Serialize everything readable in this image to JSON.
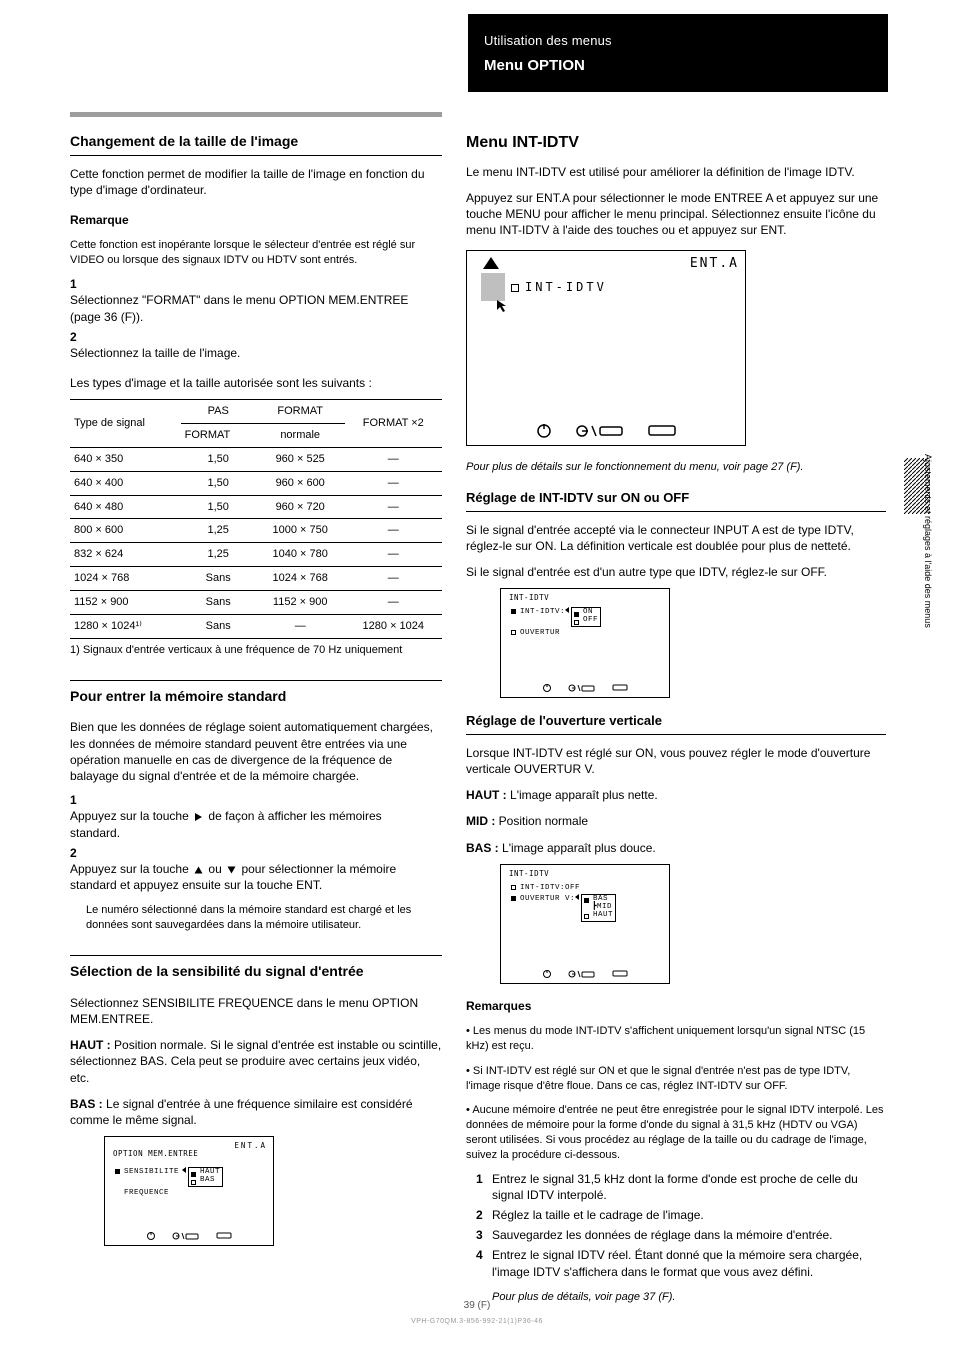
{
  "header": {
    "black_line1": "Utilisation des menus",
    "black_line2": "Menu OPTION"
  },
  "left": {
    "section1_title": "Changement de la taille de l'image",
    "section1_p1": "Cette fonction permet de modifier la taille de l'image en fonction du type d'image d'ordinateur.",
    "note_head": "Remarque",
    "note_body": "Cette fonction est inopérante lorsque le sélecteur d'entrée est réglé sur VIDEO ou lorsque des signaux IDTV ou HDTV sont entrés.",
    "step1": "Sélectionnez \"FORMAT\" dans le menu OPTION MEM.ENTREE (page 36 (F)).",
    "step2": "Sélectionnez la taille de l'image.",
    "formats_intro": "Les types d'image et la taille autorisée sont les suivants :",
    "table_note": "1) Signaux d'entrée verticaux à une fréquence de 70 Hz uniquement",
    "section2_title": "Pour entrer la mémoire standard",
    "section2_body": "Bien que les données de réglage soient automatiquement chargées, les données de mémoire standard peuvent être entrées via une opération manuelle en cas de divergence de la fréquence de balayage du signal d'entrée et de la mémoire chargée.",
    "section2_step1a": "Appuyez sur la touche ",
    "section2_step1b": " de façon à afficher les mémoires standard.",
    "section2_step2a": "Appuyez sur la touche ",
    "section2_step2b": " ou ",
    "section2_step2c": " pour sélectionner la mémoire standard et appuyez ensuite sur la touche ENT.",
    "section2_step3": "Le numéro sélectionné dans la mémoire standard est chargé et les données sont sauvegardées dans la mémoire utilisateur.",
    "section3_title": "Sélection de la sensibilité du signal d'entrée",
    "section3_step1": "Sélectionnez SENSIBILITE FREQUENCE dans le menu OPTION MEM.ENTREE.",
    "section3_step2a": "HAUT :",
    "section3_step2b": "Position normale. Si le signal d'entrée est instable ou scintille, sélectionnez BAS. Cela peut se produire avec certains jeux vidéo, etc.",
    "section3_step2c": "BAS :",
    "section3_step2d": "Le signal d'entrée à une fréquence similaire est considéré comme le même signal.",
    "osd_s3_title": "OPTION MEM.ENTREE",
    "osd_s3_enta": "ENT.A",
    "osd_s3_row1": "SENSIBILITE",
    "osd_s3_row2": "FREQUENCE",
    "osd_s3_opt1": "HAUT",
    "osd_s3_opt2": "BAS"
  },
  "right": {
    "intidtv_title": "Menu INT-IDTV",
    "intidtv_p1": "Le menu INT-IDTV est utilisé pour améliorer la définition de l'image IDTV.",
    "intidtv_p2": "Appuyez sur ENT.A pour sélectionner le mode ENTREE A et appuyez sur une touche MENU pour afficher le menu principal. Sélectionnez ensuite l'icône du menu INT-IDTV à l'aide des touches     ou     et appuyez sur ENT.",
    "osd_main_item": "INT-IDTV",
    "osd_main_enta": "ENT.A",
    "osd_main_foot": "Pour plus de détails sur le fonctionnement du menu, voir page 27 (F).",
    "sec_onoff_title": "Réglage de INT-IDTV sur ON ou OFF",
    "sec_onoff_b1": "Si le signal d'entrée accepté via le connecteur INPUT A est de type IDTV, réglez-le sur ON. La définition verticale est doublée pour plus de netteté.",
    "sec_onoff_b2": "Si le signal d'entrée est d'un autre type que IDTV, réglez-le sur OFF.",
    "osd_onoff_title": "INT-IDTV",
    "osd_onoff_row1": "INT-IDTV:",
    "osd_onoff_row2": "OUVERTUR",
    "osd_onoff_opt1": "ON",
    "osd_onoff_opt2": "OFF",
    "sec_vap_title": "Réglage de l'ouverture verticale",
    "sec_vap_p": "Lorsque INT-IDTV est réglé sur ON, vous pouvez régler le mode d'ouverture verticale OUVERTUR V.",
    "sec_vap_haut_l": "HAUT :",
    "sec_vap_haut_r": "L'image apparaît plus nette.",
    "sec_vap_mid_l": "MID :",
    "sec_vap_mid_r": "Position normale",
    "sec_vap_bas_l": "BAS :",
    "sec_vap_bas_r": "L'image apparaît plus douce.",
    "osd_vap_title": "INT-IDTV",
    "osd_vap_row1": "INT-IDTV:OFF",
    "osd_vap_row2": "OUVERTUR V:",
    "osd_vap_opt1": "BAS",
    "osd_vap_opt2": "MID",
    "osd_vap_opt3": "HAUT",
    "note_head": "Remarques",
    "note1": "Les menus du mode INT-IDTV s'affichent uniquement lorsqu'un signal NTSC (15 kHz) est reçu.",
    "note2": "Si INT-IDTV est réglé sur ON et que le signal d'entrée n'est pas de type IDTV, l'image risque d'être floue. Dans ce cas, réglez INT-IDTV sur OFF.",
    "note3p": "Aucune mémoire d'entrée ne peut être enregistrée pour le signal IDTV interpolé. Les données de mémoire pour la forme d'onde du signal à 31,5 kHz (HDTV ou VGA) seront utilisées. Si vous procédez au réglage de la taille ou du cadrage de l'image, suivez la procédure ci-dessous.",
    "note3_1": "Entrez le signal 31,5 kHz dont la forme d'onde est proche de celle du signal IDTV interpolé.",
    "note3_2": "Réglez la taille et le cadrage de l'image.",
    "note3_3": "Sauvegardez les données de réglage dans la mémoire d'entrée.",
    "note3_4p": "Entrez le signal IDTV réel. Étant donné que la mémoire sera chargée, l'image IDTV s'affichera dans le format que vous avez défini.",
    "note3_4tail": "Pour plus de détails, voir page 37 (F)."
  },
  "sizes_table": {
    "head_c1": "Type de signal",
    "head_c2a": "PAS",
    "head_c2b": "FORMAT",
    "head_c3a": "FORMAT",
    "head_c3b": "normale",
    "head_c4": "FORMAT ×2",
    "rows": [
      [
        "640 × 350",
        "1,50",
        "960 × 525",
        "—"
      ],
      [
        "640 × 400",
        "1,50",
        "960 × 600",
        "—"
      ],
      [
        "640 × 480",
        "1,50",
        "960 × 720",
        "—"
      ],
      [
        "800 × 600",
        "1,25",
        "1000 × 750",
        "—"
      ],
      [
        "832 × 624",
        "1,25",
        "1040 × 780",
        "—"
      ],
      [
        "1024 × 768",
        "Sans",
        "1024 × 768",
        "—"
      ],
      [
        "1152 × 900",
        "Sans",
        "1152 × 900",
        "—"
      ],
      [
        "1280 × 1024¹⁾",
        "Sans",
        "—",
        "1280 × 1024"
      ]
    ]
  },
  "side_label": "Ajustements et réglages à l'aide des menus",
  "page_number": "39 (F)",
  "footer_code": "VPH-G70QM.3-856-992-21(1)P36-46"
}
